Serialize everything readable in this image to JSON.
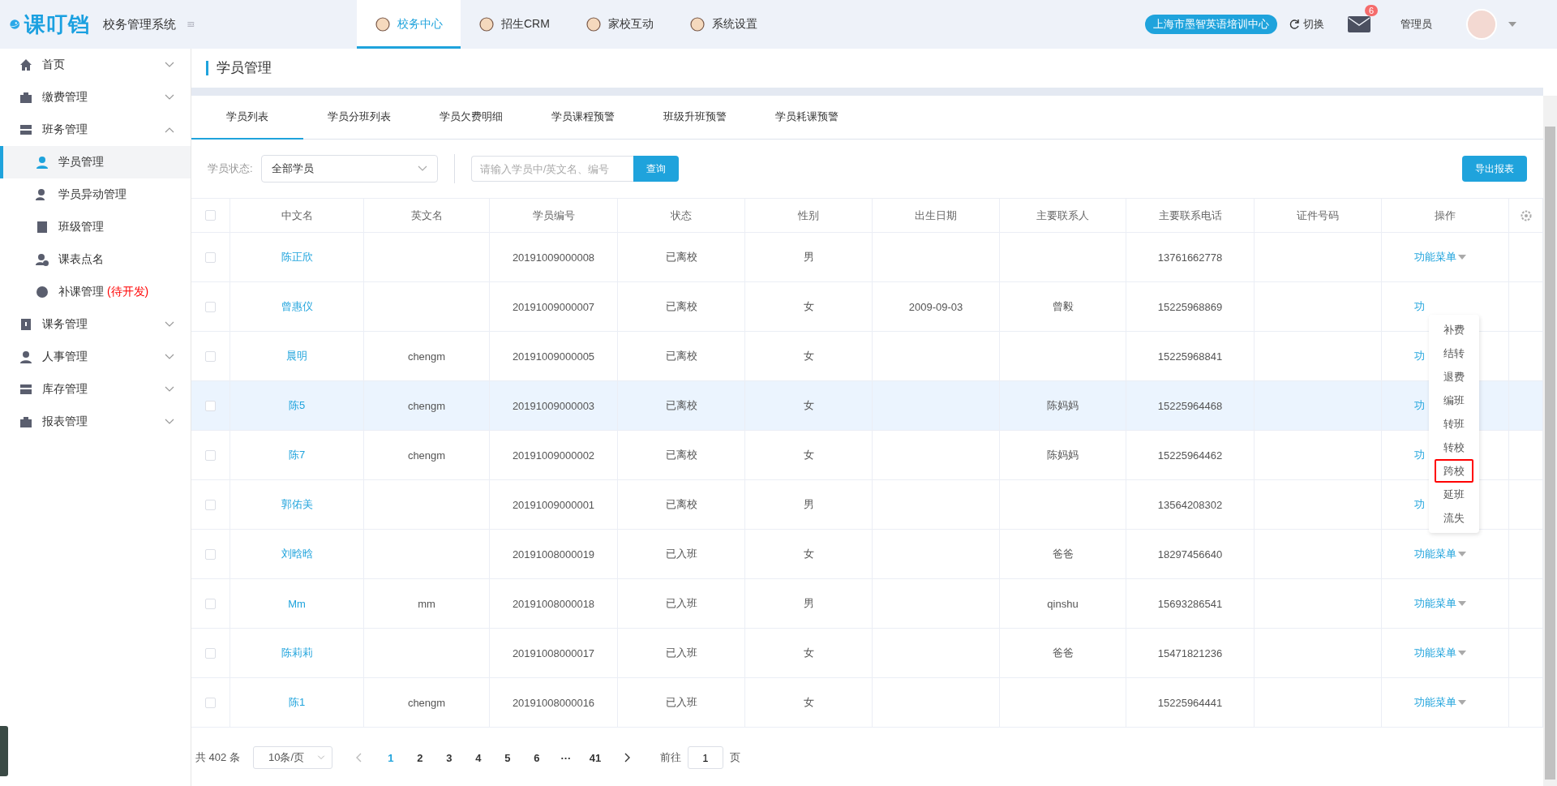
{
  "header": {
    "logo": "课叮铛",
    "system_name": "校务管理系统",
    "nav": [
      {
        "label": "校务中心",
        "selected": true
      },
      {
        "label": "招生CRM",
        "selected": false
      },
      {
        "label": "家校互动",
        "selected": false
      },
      {
        "label": "系统设置",
        "selected": false
      }
    ],
    "campus": "上海市墨智英语培训中心",
    "switch": "切换",
    "mail_badge": "6",
    "user": "管理员"
  },
  "sidebar": {
    "items": [
      {
        "label": "首页",
        "expanded": false
      },
      {
        "label": "缴费管理",
        "expanded": false
      },
      {
        "label": "班务管理",
        "expanded": true,
        "children": [
          {
            "label": "学员管理",
            "selected": true
          },
          {
            "label": "学员异动管理",
            "selected": false
          },
          {
            "label": "班级管理",
            "selected": false
          },
          {
            "label": "课表点名",
            "selected": false
          },
          {
            "label": "补课管理",
            "note": "(待开发)",
            "selected": false
          }
        ]
      },
      {
        "label": "课务管理",
        "expanded": false
      },
      {
        "label": "人事管理",
        "expanded": false
      },
      {
        "label": "库存管理",
        "expanded": false
      },
      {
        "label": "报表管理",
        "expanded": false
      }
    ]
  },
  "page_title": "学员管理",
  "tabs": [
    {
      "label": "学员列表",
      "selected": true
    },
    {
      "label": "学员分班列表",
      "selected": false
    },
    {
      "label": "学员欠费明细",
      "selected": false
    },
    {
      "label": "学员课程预警",
      "selected": false
    },
    {
      "label": "班级升班预警",
      "selected": false
    },
    {
      "label": "学员耗课预警",
      "selected": false
    }
  ],
  "filter": {
    "label": "学员状态:",
    "value": "全部学员",
    "search_placeholder": "请输入学员中/英文名、编号",
    "search_button": "查询",
    "export_button": "导出报表"
  },
  "table": {
    "all_checked": false,
    "columns": [
      "中文名",
      "英文名",
      "学员编号",
      "状态",
      "性别",
      "出生日期",
      "主要联系人",
      "主要联系电话",
      "证件号码",
      "操作"
    ],
    "rows": [
      {
        "selected": false,
        "checked": false,
        "name": "陈正欣",
        "student_no": "20191009000008",
        "status": "已离校",
        "gender": "男",
        "phone": "13761662778",
        "operation": {
          "text": "功能菜单",
          "caret": true
        }
      },
      {
        "selected": false,
        "checked": false,
        "name": "曾惠仪",
        "student_no": "20191009000007",
        "status": "已离校",
        "gender": "女",
        "birth_date": "2009-09-03",
        "contact": "曾毅",
        "phone": "15225968869",
        "operation": {
          "text": "功",
          "caret": false
        }
      },
      {
        "selected": false,
        "checked": false,
        "name": "晨明",
        "english_name": "chengm",
        "student_no": "20191009000005",
        "status": "已离校",
        "gender": "女",
        "phone": "15225968841",
        "operation": {
          "text": "功",
          "caret": false
        }
      },
      {
        "selected": true,
        "checked": false,
        "name": "陈5",
        "english_name": "chengm",
        "student_no": "20191009000003",
        "status": "已离校",
        "gender": "女",
        "contact": "陈妈妈",
        "phone": "15225964468",
        "operation": {
          "text": "功",
          "caret": false
        }
      },
      {
        "selected": false,
        "checked": false,
        "name": "陈7",
        "english_name": "chengm",
        "student_no": "20191009000002",
        "status": "已离校",
        "gender": "女",
        "contact": "陈妈妈",
        "phone": "15225964462",
        "operation": {
          "text": "功",
          "caret": false
        }
      },
      {
        "selected": false,
        "checked": false,
        "name": "郭佑美",
        "student_no": "20191009000001",
        "status": "已离校",
        "gender": "男",
        "phone": "13564208302",
        "operation": {
          "text": "功",
          "caret": false
        }
      },
      {
        "selected": false,
        "checked": false,
        "name": "刘晗晗",
        "student_no": "20191008000019",
        "status": "已入班",
        "gender": "女",
        "contact": "爸爸",
        "phone": "18297456640",
        "operation": {
          "text": "功能菜单",
          "caret": true,
          "menu": [
            {
              "label": "补费",
              "highlighted": false
            },
            {
              "label": "结转",
              "highlighted": false
            },
            {
              "label": "退费",
              "highlighted": false
            },
            {
              "label": "编班",
              "highlighted": false
            },
            {
              "label": "转班",
              "highlighted": false
            },
            {
              "label": "转校",
              "highlighted": false
            },
            {
              "label": "跨校",
              "highlighted": true
            },
            {
              "label": "延班",
              "highlighted": false
            },
            {
              "label": "流失",
              "highlighted": false
            }
          ]
        }
      },
      {
        "selected": false,
        "checked": false,
        "name": "Mm",
        "english_name": "mm",
        "student_no": "20191008000018",
        "status": "已入班",
        "gender": "男",
        "contact": "qinshu",
        "phone": "15693286541",
        "operation": {
          "text": "功能菜单",
          "caret": true
        }
      },
      {
        "selected": false,
        "checked": false,
        "name": "陈莉莉",
        "student_no": "20191008000017",
        "status": "已入班",
        "gender": "女",
        "contact": "爸爸",
        "phone": "15471821236",
        "operation": {
          "text": "功能菜单",
          "caret": true
        }
      },
      {
        "selected": false,
        "checked": false,
        "name": "陈1",
        "english_name": "chengm",
        "student_no": "20191008000016",
        "status": "已入班",
        "gender": "女",
        "phone": "15225964441",
        "operation": {
          "text": "功能菜单",
          "caret": true
        }
      }
    ]
  },
  "pagination": {
    "total": "共 402 条",
    "page_size": "10条/页",
    "pages": [
      {
        "label": "1",
        "selected": true
      },
      {
        "label": "2",
        "selected": false
      },
      {
        "label": "3",
        "selected": false
      },
      {
        "label": "4",
        "selected": false
      },
      {
        "label": "5",
        "selected": false
      },
      {
        "label": "6",
        "selected": false
      },
      {
        "label": "···",
        "selected": false
      },
      {
        "label": "41",
        "selected": false
      }
    ],
    "goto_label": "前往",
    "goto_value": "1",
    "page_suffix": "页"
  }
}
